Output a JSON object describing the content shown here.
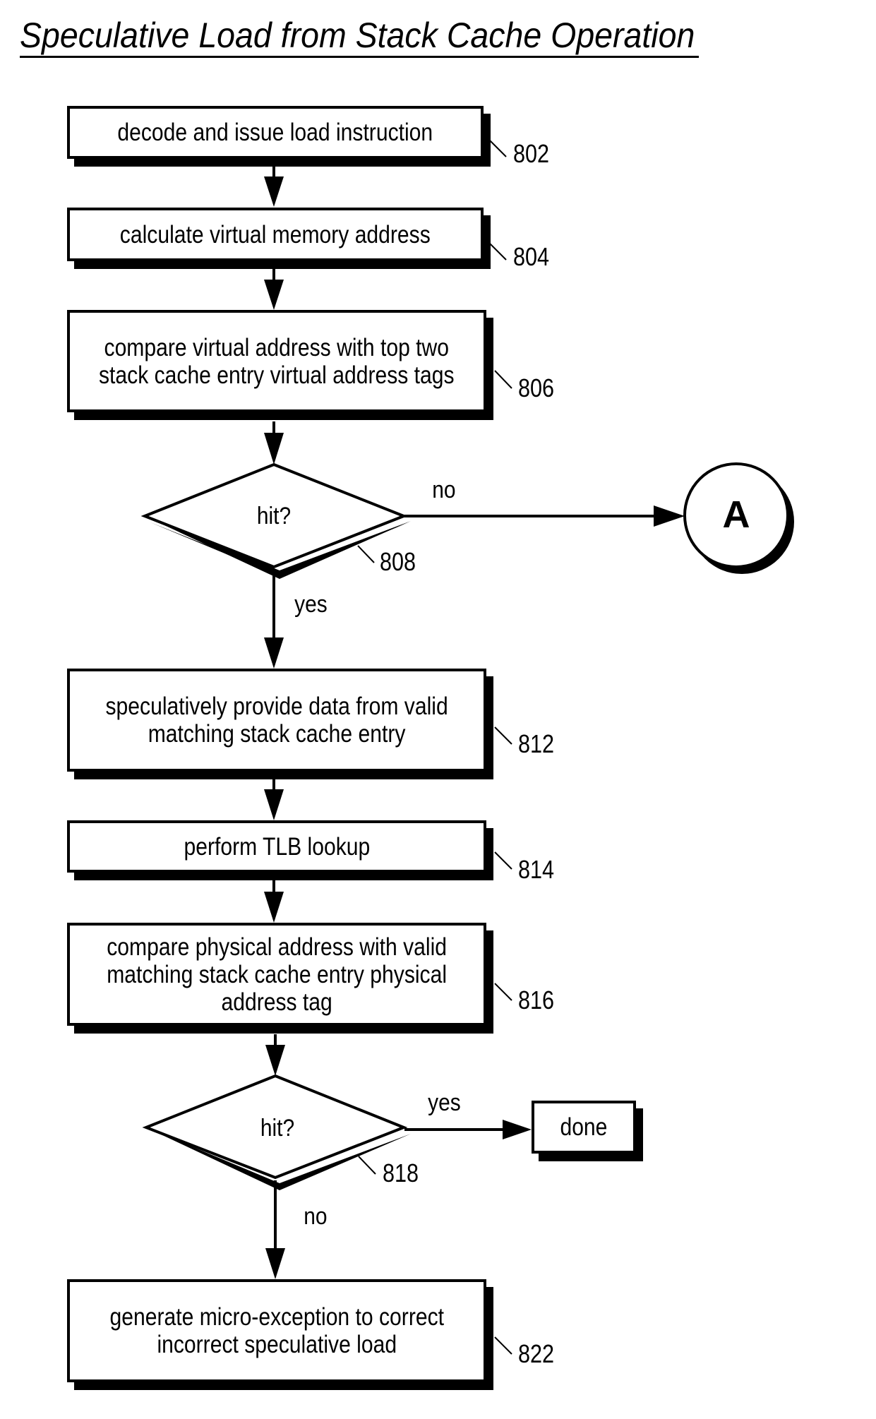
{
  "title": "Speculative Load from Stack Cache Operation",
  "steps": {
    "s802": {
      "ref": "802",
      "lines": [
        "decode and issue load instruction"
      ]
    },
    "s804": {
      "ref": "804",
      "lines": [
        "calculate virtual memory address"
      ]
    },
    "s806": {
      "ref": "806",
      "lines": [
        "compare virtual address with top two",
        "stack cache entry virtual address tags"
      ]
    },
    "s808": {
      "ref": "808",
      "text": "hit?",
      "yes_label": "yes",
      "no_label": "no"
    },
    "s812": {
      "ref": "812",
      "lines": [
        "speculatively provide data from valid",
        "matching stack cache entry"
      ]
    },
    "s814": {
      "ref": "814",
      "lines": [
        "perform TLB lookup"
      ]
    },
    "s816": {
      "ref": "816",
      "lines": [
        "compare physical address with valid",
        "matching stack cache entry physical",
        "address tag"
      ]
    },
    "s818": {
      "ref": "818",
      "text": "hit?",
      "yes_label": "yes",
      "no_label": "no"
    },
    "s822": {
      "ref": "822",
      "lines": [
        "generate micro-exception to correct",
        "incorrect speculative load"
      ]
    }
  },
  "connector": {
    "label": "A"
  },
  "terminal": {
    "label": "done"
  }
}
